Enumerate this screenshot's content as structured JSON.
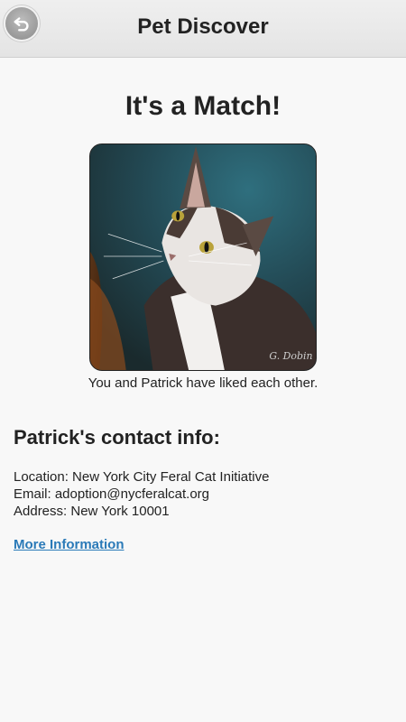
{
  "header": {
    "title": "Pet Discover",
    "back_icon": "back-arrow-icon"
  },
  "match": {
    "title": "It's a Match!",
    "caption": "You and Patrick have liked each other.",
    "photo_watermark": "G. Dobin"
  },
  "contact": {
    "heading": "Patrick's contact info:",
    "location": "Location: New York City Feral Cat Initiative",
    "email": "Email: adoption@nycferalcat.org",
    "address": "Address: New York 10001",
    "more_link": "More Information"
  },
  "colors": {
    "link": "#2a7ab8",
    "header_bg": "#e9e9e9",
    "page_bg": "#f8f8f8"
  }
}
